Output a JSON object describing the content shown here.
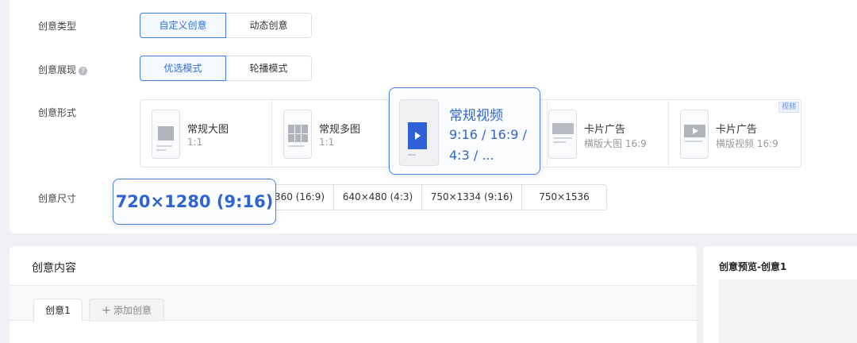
{
  "type_row": {
    "label": "创意类型",
    "options": [
      "自定义创意",
      "动态创意"
    ],
    "selected": "自定义创意"
  },
  "display_row": {
    "label": "创意展现",
    "help_icon": "question-circle-icon",
    "options": [
      "优选模式",
      "轮播模式"
    ],
    "selected": "优选模式"
  },
  "form_row": {
    "label": "创意形式",
    "items": [
      {
        "title": "常规大图",
        "sub": "1:1"
      },
      {
        "title": "常规多图",
        "sub": "1:1"
      },
      {
        "title": "常规视频",
        "sub": "9:16 / 16:9 / 4:3 / ..."
      },
      {
        "title": "卡片广告",
        "sub": "横版大图 16:9"
      },
      {
        "title": "卡片广告",
        "sub": "横版视频 16:9",
        "tag": "视频"
      }
    ],
    "selected": "常规视频"
  },
  "size_row": {
    "label": "创意尺寸",
    "highlight": "720×1280 (9:16)",
    "options": [
      "360 (16:9)",
      "640×480 (4:3)",
      "750×1334 (9:16)",
      "750×1536"
    ]
  },
  "content": {
    "title": "创意内容",
    "tabs": {
      "active": "创意1",
      "add": "添加创意"
    }
  },
  "preview": {
    "title": "创意预览-创意1"
  },
  "colors": {
    "accent": "#2f6fd6",
    "highlight_border": "#4a80e4",
    "video_block": "#2f62d6"
  }
}
